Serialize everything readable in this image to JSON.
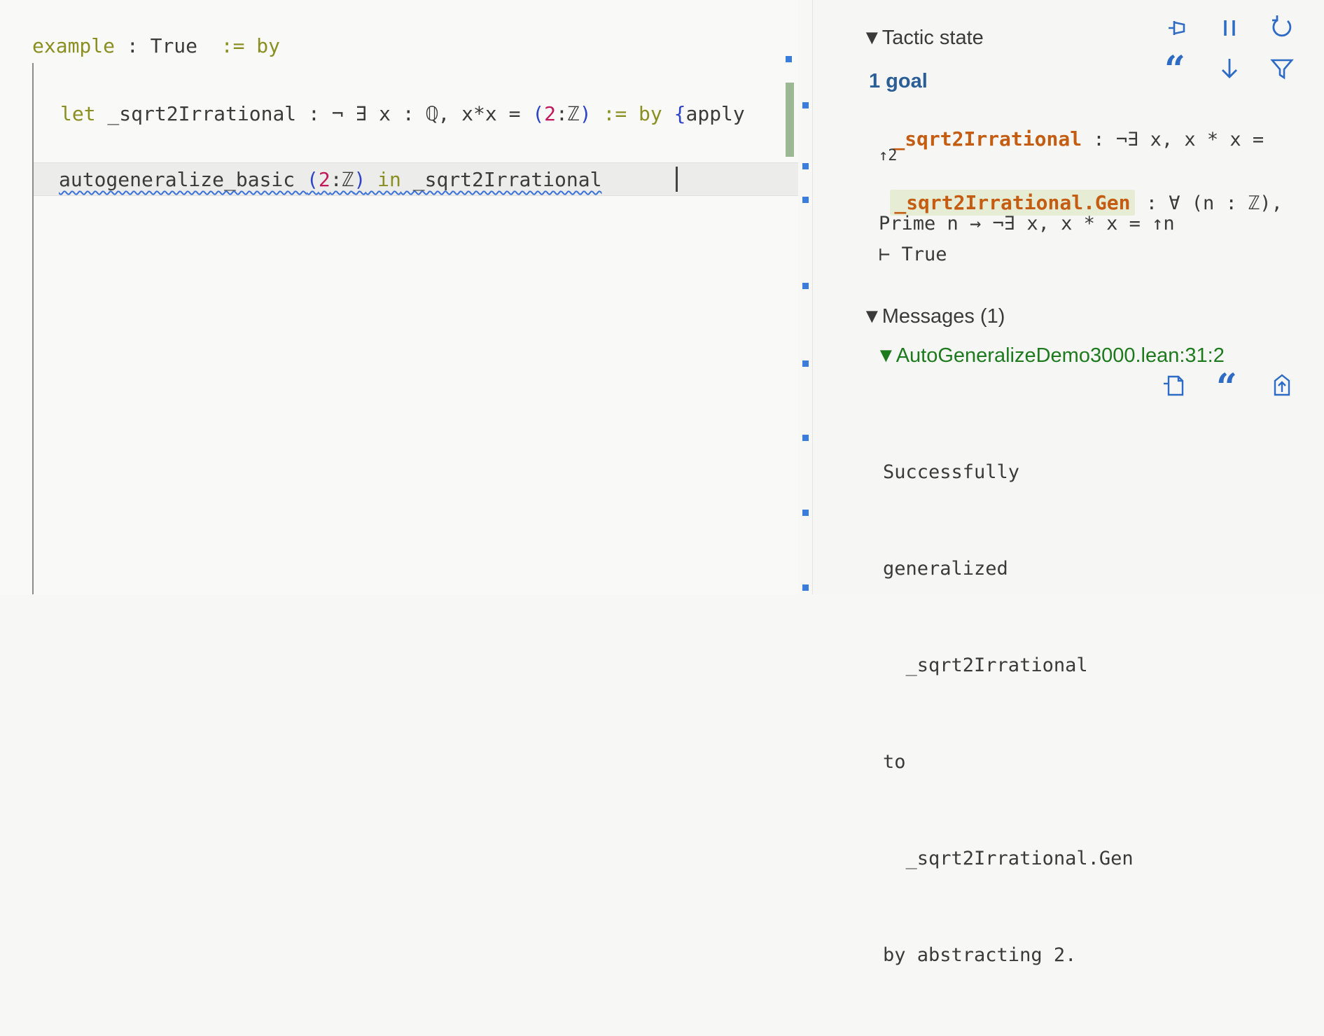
{
  "editor": {
    "line1": {
      "kw_example": "example",
      "rest": " : True ",
      "kw_assign": " := by"
    },
    "line2": {
      "kw_let": "let",
      "name": " _sqrt2Irrational : ¬ ∃ x : ℚ, x*x = ",
      "paren_open": "(",
      "num": "2",
      "type": ":ℤ",
      "paren_close": ")",
      "assign": " := by ",
      "brace": "{",
      "tail": "apply"
    },
    "line3": {
      "cmd": "autogeneralize_basic ",
      "paren_open": "(",
      "num": "2",
      "type": ":ℤ",
      "paren_close": ")",
      "kw_in": " in",
      "target": " _sqrt2Irrational"
    }
  },
  "infoview": {
    "tactic_state": "▼Tactic state",
    "goal_count": "1 goal",
    "hyp1_name": "_sqrt2Irrational",
    "hyp1_type": " : ¬∃ x, x * x =",
    "hyp1_cont": "↑2",
    "hyp2_name": "_sqrt2Irrational.Gen",
    "hyp2_type": " : ∀ (n : ℤ),",
    "hyp2_cont": "Prime n → ¬∃ x, x * x = ↑n",
    "goal": "⊢ True",
    "messages_head": "▼Messages (1)",
    "message_location": "▼AutoGeneralizeDemo3000.lean:31:2",
    "message_lines": [
      "Successfully",
      "generalized",
      "  _sqrt2Irrational",
      "to",
      "  _sqrt2Irrational.Gen",
      "by abstracting 2."
    ],
    "icons": {
      "toolbar_top": [
        "pin-icon",
        "pause-icon",
        "refresh-icon"
      ],
      "toolbar_second": [
        "quote-icon",
        "arrow-down-icon",
        "filter-icon"
      ],
      "message_actions": [
        "copy-to-comment-icon",
        "quote-icon",
        "goto-location-icon"
      ]
    },
    "quote_glyph": "“"
  }
}
